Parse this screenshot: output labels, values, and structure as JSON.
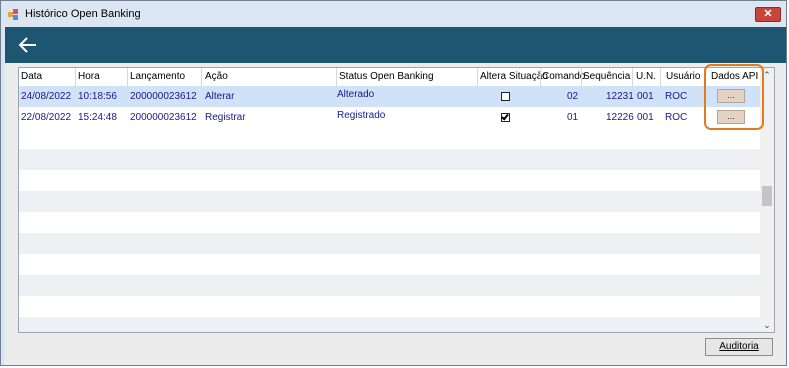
{
  "window": {
    "title": "Histórico Open Banking",
    "close_label": "✕"
  },
  "header": {
    "back_icon": "arrow-left-icon"
  },
  "grid": {
    "columns": [
      "Data",
      "Hora",
      "Lançamento",
      "Ação",
      "Status Open Banking",
      "Altera Situação",
      "Comando",
      "Sequência",
      "U.N.",
      "Usuário",
      "Dados API"
    ],
    "rows": [
      {
        "data": "24/08/2022",
        "hora": "10:18:56",
        "lancamento": "200000023612",
        "acao": "Alterar",
        "status": "Alterado",
        "altera_situacao": false,
        "comando": "02",
        "sequencia": "12231",
        "un": "001",
        "usuario": "ROC",
        "dados_api": "..."
      },
      {
        "data": "22/08/2022",
        "hora": "15:24:48",
        "lancamento": "200000023612",
        "acao": "Registrar",
        "status": "Registrado",
        "altera_situacao": true,
        "comando": "01",
        "sequencia": "12226",
        "un": "001",
        "usuario": "ROC",
        "dados_api": "..."
      }
    ]
  },
  "footer": {
    "auditoria_label": "Auditoria"
  },
  "colors": {
    "header_band": "#1e5570",
    "selected_row": "#cfe2f7",
    "highlight": "#e07b1f"
  }
}
